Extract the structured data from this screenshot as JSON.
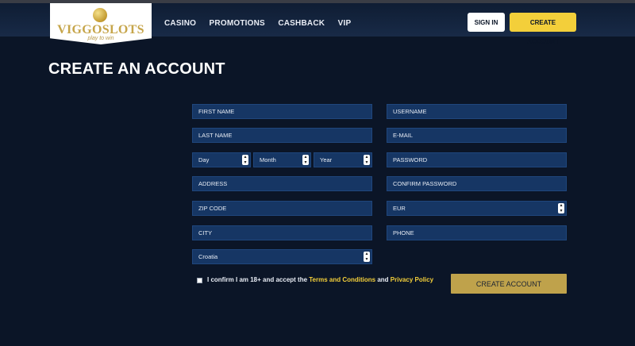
{
  "header": {
    "logo_text": "VIGGOSLOTS",
    "logo_tagline": "play to win",
    "nav": [
      {
        "label": "CASINO"
      },
      {
        "label": "PROMOTIONS"
      },
      {
        "label": "CASHBACK"
      },
      {
        "label": "VIP"
      }
    ],
    "sign_in_label": "SIGN IN",
    "create_account_label": "CREATE ACCOUNT"
  },
  "page": {
    "title": "CREATE AN ACCOUNT"
  },
  "form": {
    "first_name": "FIRST NAME",
    "last_name": "LAST NAME",
    "dob": {
      "day": "Day",
      "month": "Month",
      "year": "Year"
    },
    "address": "ADDRESS",
    "zip_code": "ZIP CODE",
    "city": "CITY",
    "country": "Croatia",
    "username": "USERNAME",
    "email": "E-MAIL",
    "password": "PASSWORD",
    "confirm_password": "CONFIRM PASSWORD",
    "currency": "EUR",
    "phone": "PHONE",
    "consent_prefix": "I confirm I am 18+ and accept the ",
    "terms_link": "Terms and Conditions",
    "consent_and": " and ",
    "privacy_link": "Privacy Policy",
    "submit_label": "CREATE ACCOUNT"
  },
  "colors": {
    "background": "#0b1527",
    "field": "#163664",
    "accent_yellow": "#f3cf3a",
    "submit_gold": "#bfa24b"
  }
}
